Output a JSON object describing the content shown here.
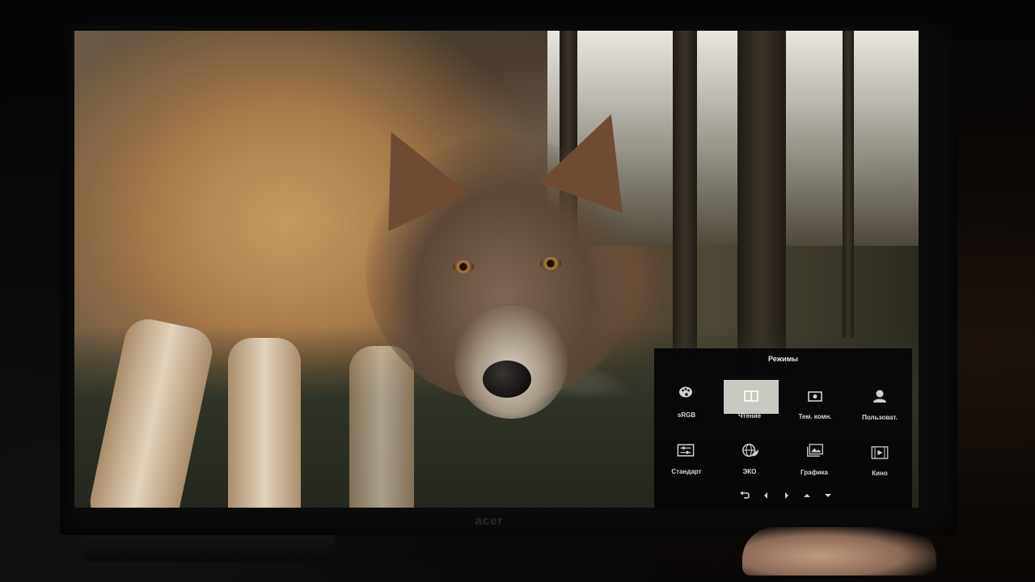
{
  "monitor": {
    "brand_logo": "acer"
  },
  "osd": {
    "title": "Режимы",
    "modes": [
      {
        "label": "sRGB",
        "icon": "palette-icon",
        "selected": false
      },
      {
        "label": "Чтение",
        "icon": "book-icon",
        "selected": true
      },
      {
        "label": "Тем. комн.",
        "icon": "dark-room-icon",
        "selected": false
      },
      {
        "label": "Пользоват.",
        "icon": "user-icon",
        "selected": false
      },
      {
        "label": "Стандарт",
        "icon": "sliders-icon",
        "selected": false
      },
      {
        "label": "ЭКО",
        "icon": "eco-globe-icon",
        "selected": false
      },
      {
        "label": "Графика",
        "icon": "picture-icon",
        "selected": false
      },
      {
        "label": "Кино",
        "icon": "film-icon",
        "selected": false
      }
    ],
    "nav_buttons": [
      "back-icon",
      "left-arrow-icon",
      "right-arrow-icon",
      "up-arrow-icon",
      "down-arrow-icon"
    ],
    "selection_color": "#c9c9c2",
    "panel_color": "#060608"
  }
}
